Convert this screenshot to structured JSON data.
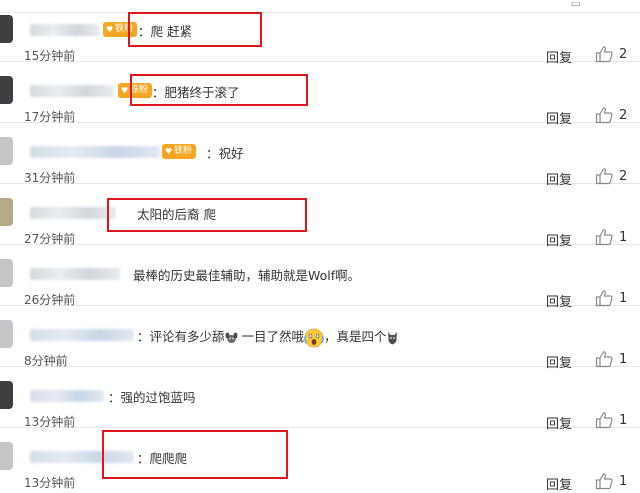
{
  "badges": {
    "iron": "铁粉",
    "iron_fan": "铁粉"
  },
  "comments": [
    {
      "text": "：爬 赶紧",
      "time": "15分钟前",
      "reply": "回复",
      "likes": "2"
    },
    {
      "text": "：肥猪终于滚了",
      "time": "17分钟前",
      "reply": "回复",
      "likes": "2"
    },
    {
      "text": "：祝好",
      "time": "31分钟前",
      "reply": "回复",
      "likes": "2"
    },
    {
      "text": "太阳的后裔 爬",
      "time": "27分钟前",
      "reply": "回复",
      "likes": "1"
    },
    {
      "text": "最棒的历史最佳辅助，辅助就是Wolf啊。",
      "time": "26分钟前",
      "reply": "回复",
      "likes": "1"
    },
    {
      "text_a": "：评论有多少舔",
      "text_b": " 一目了然哦",
      "text_c": "，真是四个",
      "time": "8分钟前",
      "reply": "回复",
      "likes": "1"
    },
    {
      "text": "：强的过饱蓝吗",
      "time": "13分钟前",
      "reply": "回复",
      "likes": "1"
    },
    {
      "text": "：爬爬爬",
      "time": "13分钟前",
      "reply": "回复",
      "likes": "1"
    }
  ],
  "icons": {
    "like": "thumbs-up-icon",
    "dog": "dog-face-emoji",
    "scared": "scared-face-emoji",
    "wolf": "wolf-emoji"
  },
  "colors": {
    "highlight_box": "#e0161d",
    "badge": "#f5a623",
    "divider": "#e8e8e8"
  }
}
